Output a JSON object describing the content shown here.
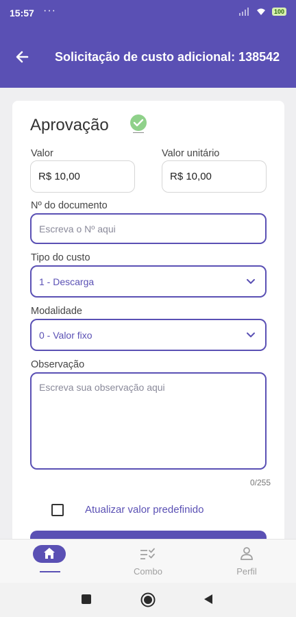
{
  "status": {
    "time": "15:57",
    "dots": "···",
    "battery": "100"
  },
  "header": {
    "title": "Solicitação de custo adicional: 138542"
  },
  "card": {
    "title": "Aprovação",
    "valor": {
      "label": "Valor",
      "value": "R$ 10,00"
    },
    "valor_unitario": {
      "label": "Valor unitário",
      "value": "R$ 10,00"
    },
    "documento": {
      "label": "Nº do documento",
      "placeholder": "Escreva o Nº aqui"
    },
    "tipo_custo": {
      "label": "Tipo do custo",
      "selected": "1 - Descarga"
    },
    "modalidade": {
      "label": "Modalidade",
      "selected": "0 - Valor fixo"
    },
    "observacao": {
      "label": "Observação",
      "placeholder": "Escreva sua observação aqui",
      "counter": "0/255"
    },
    "checkbox": {
      "label": "Atualizar valor predefinido",
      "checked": false
    }
  },
  "bottom_nav": {
    "items": [
      {
        "label": "",
        "icon": "home-icon",
        "active": true
      },
      {
        "label": "Combo",
        "icon": "checklist-icon",
        "active": false
      },
      {
        "label": "Perfil",
        "icon": "person-icon",
        "active": false
      }
    ]
  },
  "colors": {
    "primary": "#5a50b4",
    "success": "#8fd18a"
  }
}
